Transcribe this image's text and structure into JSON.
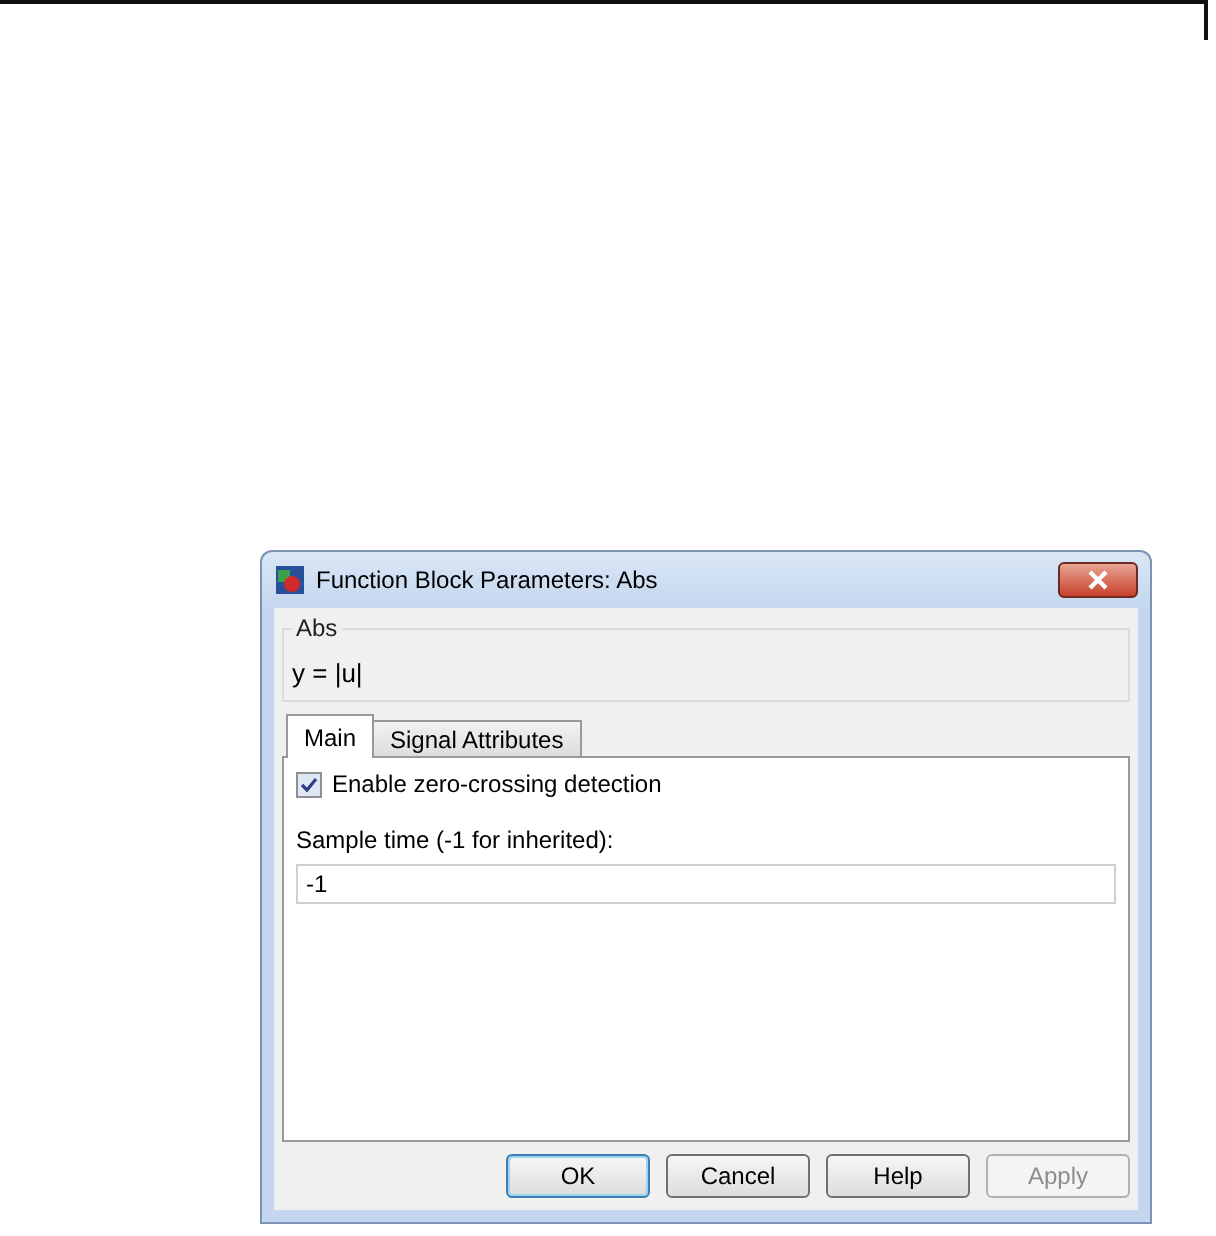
{
  "window": {
    "title": "Function Block Parameters: Abs"
  },
  "description": {
    "heading": "Abs",
    "text": "y = |u|"
  },
  "tabs": [
    {
      "label": "Main",
      "selected": true
    },
    {
      "label": "Signal Attributes",
      "selected": false
    }
  ],
  "parameters": [
    {
      "kind": "checkbox",
      "label": "Enable zero-crossing detection",
      "checked": true
    },
    {
      "kind": "field",
      "label": "Sample time (-1 for inherited):",
      "value": "-1"
    }
  ],
  "buttons": [
    {
      "label": "OK",
      "default": true,
      "disabled": false
    },
    {
      "label": "Cancel",
      "default": false,
      "disabled": false
    },
    {
      "label": "Help",
      "default": false,
      "disabled": false
    },
    {
      "label": "Apply",
      "default": false,
      "disabled": true
    }
  ]
}
